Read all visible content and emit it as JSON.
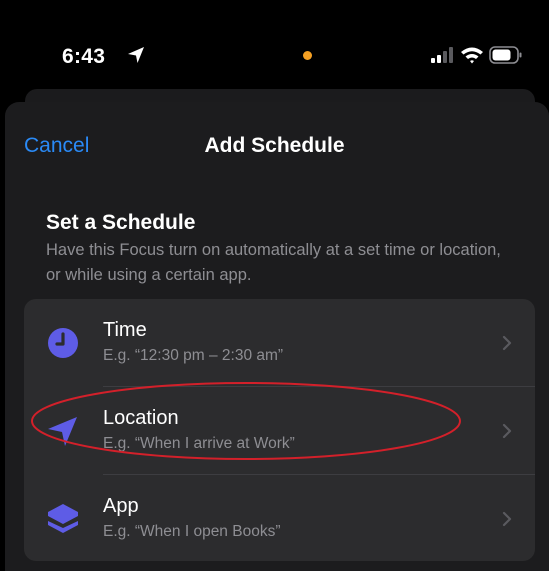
{
  "status_bar": {
    "time": "6:43",
    "location_icon": "location-arrow-icon",
    "privacy_dot_color": "#f5a023",
    "signal_icon": "cellular-signal-icon",
    "wifi_icon": "wifi-icon",
    "battery_icon": "battery-icon"
  },
  "nav": {
    "cancel_label": "Cancel",
    "title": "Add Schedule"
  },
  "section": {
    "title": "Set a Schedule",
    "description": "Have this Focus turn on automatically at a set time or location, or while using a certain app."
  },
  "options": [
    {
      "title": "Time",
      "subtitle": "E.g. “12:30 pm – 2:30 am”",
      "icon": "clock-icon",
      "icon_color": "#5e5ce6"
    },
    {
      "title": "Location",
      "subtitle": "E.g. “When I arrive at Work”",
      "icon": "location-arrow-icon",
      "icon_color": "#5e5ce6"
    },
    {
      "title": "App",
      "subtitle": "E.g. “When I open Books”",
      "icon": "app-stack-icon",
      "icon_color": "#5e5ce6"
    }
  ],
  "colors": {
    "accent_blue": "#2a8af6",
    "sheet_background": "#1c1c1e",
    "card_background": "#2c2c2e",
    "secondary_text": "#8e8e93",
    "annotation_red": "#d3202a"
  }
}
